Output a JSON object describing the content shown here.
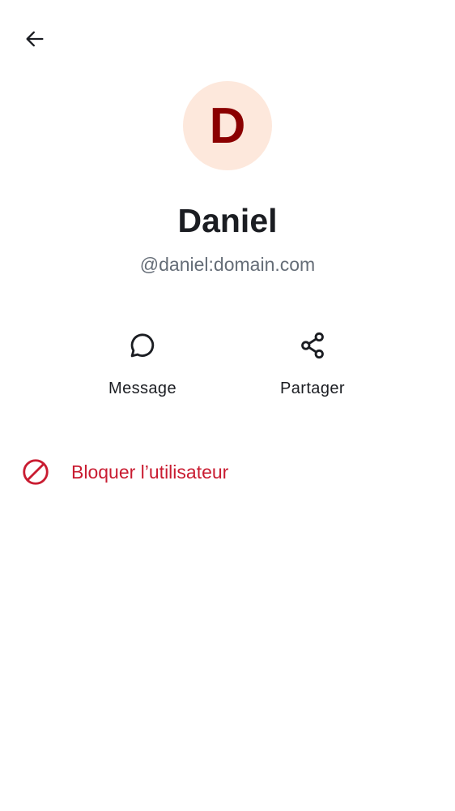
{
  "header": {
    "back_icon": "arrow-left-icon"
  },
  "profile": {
    "avatar_letter": "D",
    "avatar_bg_color": "#fde8dc",
    "avatar_fg_color": "#8b0000",
    "display_name": "Daniel",
    "user_id": "@daniel:domain.com"
  },
  "actions": [
    {
      "label": "Message",
      "icon": "chat-bubble-icon"
    },
    {
      "label": "Partager",
      "icon": "share-icon"
    }
  ],
  "block": {
    "label": "Bloquer l’utilisateur",
    "icon": "block-icon",
    "color": "#c91c31"
  }
}
